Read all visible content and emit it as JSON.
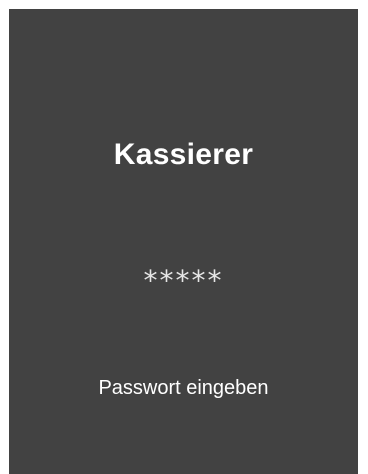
{
  "panel": {
    "title": "Kassierer",
    "password_display": "*****",
    "hint": "Passwort eingeben"
  },
  "colors": {
    "panel_background": "#424242",
    "page_background": "#ffffff",
    "text": "#ffffff"
  }
}
